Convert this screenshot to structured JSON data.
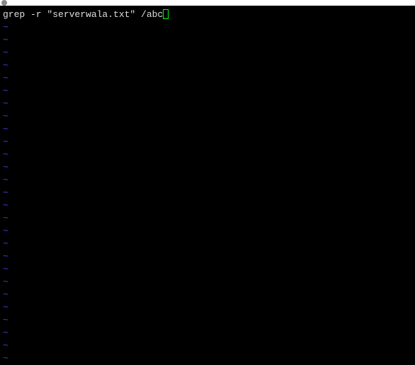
{
  "command_text": "grep -r \"serverwala.txt\" /abc",
  "tilde_char": "~",
  "tilde_count": 27
}
